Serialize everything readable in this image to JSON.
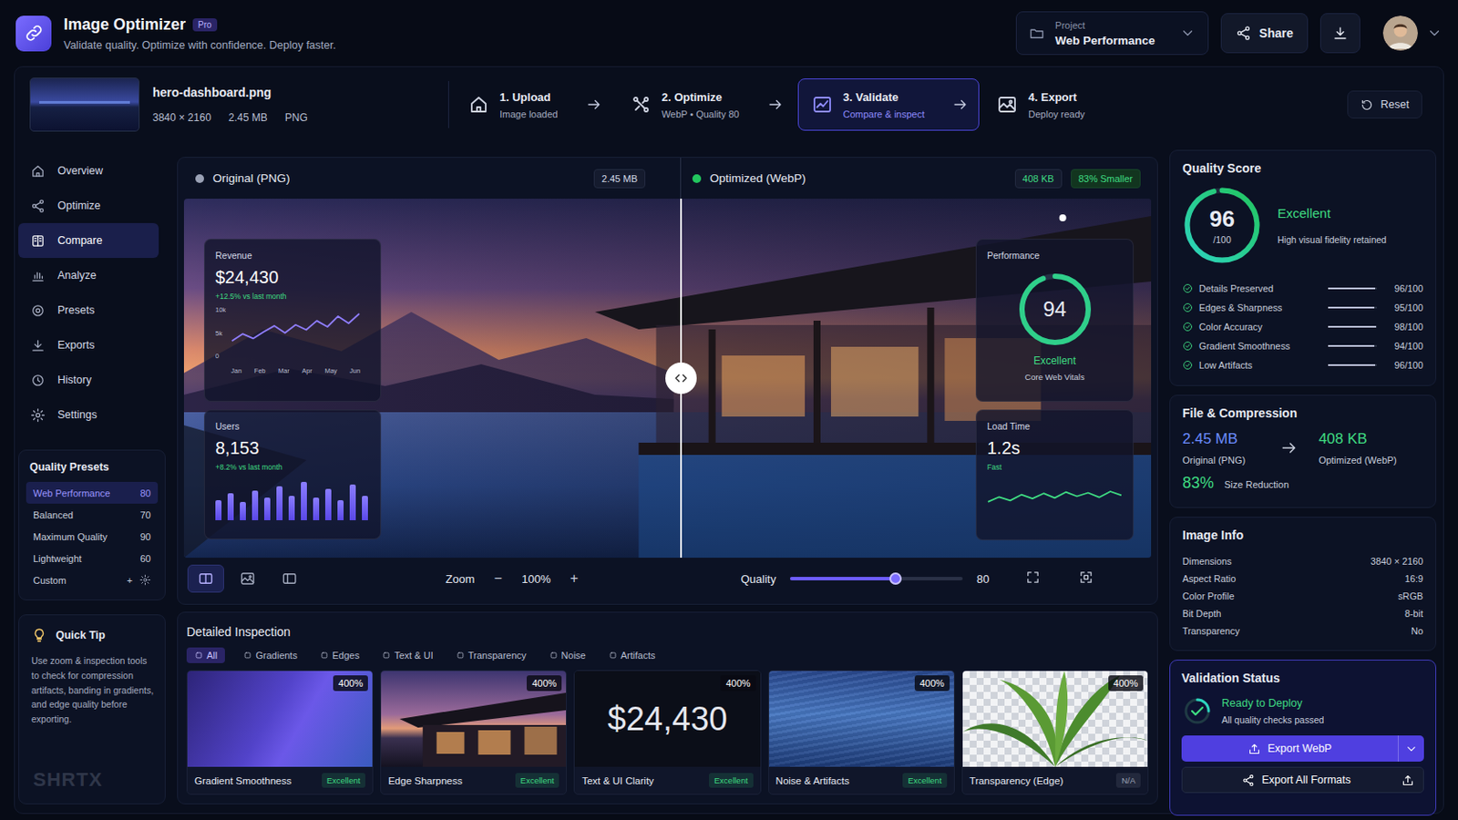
{
  "app": {
    "title": "Image Optimizer",
    "badge": "Pro",
    "subtitle": "Validate quality. Optimize with confidence. Deploy faster."
  },
  "project": {
    "label": "Project",
    "value": "Web Performance"
  },
  "header_actions": {
    "share": "Share"
  },
  "file": {
    "name": "hero-dashboard.png",
    "dimensions": "3840 × 2160",
    "size": "2.45 MB",
    "format": "PNG"
  },
  "steps": [
    {
      "title": "1. Upload",
      "subtitle": "Image loaded",
      "selected": false
    },
    {
      "title": "2. Optimize",
      "subtitle": "WebP • Quality 80",
      "selected": false
    },
    {
      "title": "3. Validate",
      "subtitle": "Compare & inspect",
      "selected": true
    },
    {
      "title": "4. Export",
      "subtitle": "Deploy ready",
      "selected": false
    }
  ],
  "reset": "Reset",
  "sidebar": {
    "items": [
      {
        "label": "Overview",
        "selected": false
      },
      {
        "label": "Optimize",
        "selected": false
      },
      {
        "label": "Compare",
        "selected": true
      },
      {
        "label": "Analyze",
        "selected": false
      },
      {
        "label": "Presets",
        "selected": false
      },
      {
        "label": "Exports",
        "selected": false
      },
      {
        "label": "History",
        "selected": false
      },
      {
        "label": "Settings",
        "selected": false
      }
    ]
  },
  "presets": {
    "title": "Quality Presets",
    "items": [
      {
        "label": "Web Performance",
        "value": "80",
        "selected": true,
        "kind": "value"
      },
      {
        "label": "Balanced",
        "value": "70",
        "selected": false,
        "kind": "value"
      },
      {
        "label": "Maximum Quality",
        "value": "90",
        "selected": false,
        "kind": "value"
      },
      {
        "label": "Lightweight",
        "value": "60",
        "selected": false,
        "kind": "value"
      },
      {
        "label": "Custom",
        "value": "+",
        "selected": false,
        "kind": "custom"
      }
    ]
  },
  "tip": {
    "title": "Quick Tip",
    "text": "Use zoom & inspection tools to check for compression artifacts, banding in gradients, and edge quality before exporting."
  },
  "brand": "SHRTX",
  "compare": {
    "original": {
      "label": "Original (PNG)",
      "size": "2.45 MB"
    },
    "optimized": {
      "label": "Optimized (WebP)",
      "size": "408 KB",
      "badge": "83% Smaller"
    },
    "split": {
      "level": 0.514
    },
    "revenue": {
      "label": "Revenue",
      "value": "$24,430",
      "delta": "+12.5% vs last month",
      "y_ticks": [
        "10k",
        "5k",
        "0"
      ],
      "x_ticks": [
        "Jan",
        "Feb",
        "Mar",
        "Apr",
        "May",
        "Jun"
      ],
      "values": [
        3.4,
        4.8,
        3.9,
        5.2,
        6.4,
        5.0,
        6.6,
        5.6,
        7.4,
        6.2,
        8.3,
        6.9,
        8.8
      ]
    },
    "users": {
      "label": "Users",
      "value": "8,153",
      "delta": "+8.2% vs last month",
      "values": [
        45,
        60,
        40,
        65,
        50,
        75,
        55,
        85,
        50,
        70,
        45,
        80,
        55
      ]
    },
    "performance": {
      "label": "Performance",
      "score": "94",
      "level": 0.94,
      "rating": "Excellent",
      "caption": "Core Web Vitals"
    },
    "load_time": {
      "label": "Load Time",
      "value": "1.2s",
      "rating": "Fast",
      "values": [
        30,
        45,
        34,
        52,
        40,
        56,
        42,
        60,
        47,
        58,
        44,
        62,
        50
      ]
    }
  },
  "toolbar": {
    "views": [
      {
        "selected": true
      },
      {
        "selected": false
      },
      {
        "selected": false
      }
    ],
    "zoom": {
      "label": "Zoom",
      "minus": "−",
      "value": "100%",
      "plus": "+"
    },
    "quality": {
      "label": "Quality",
      "level": 0.61,
      "value": "80"
    }
  },
  "inspection": {
    "title": "Detailed Inspection",
    "filters": [
      {
        "label": "All",
        "selected": true
      },
      {
        "label": "Gradients",
        "selected": false
      },
      {
        "label": "Edges",
        "selected": false
      },
      {
        "label": "Text & UI",
        "selected": false
      },
      {
        "label": "Transparency",
        "selected": false
      },
      {
        "label": "Noise",
        "selected": false
      },
      {
        "label": "Artifacts",
        "selected": false
      }
    ],
    "cards": [
      {
        "kind": "gradient",
        "zoom": "400%",
        "label": "Gradient Smoothness",
        "status": "Excellent",
        "color": "#3fdc82"
      },
      {
        "kind": "edge",
        "zoom": "400%",
        "label": "Edge Sharpness",
        "status": "Excellent",
        "color": "#3fdc82"
      },
      {
        "kind": "text",
        "zoom": "400%",
        "sample": "$24,430",
        "label": "Text & UI Clarity",
        "status": "Excellent",
        "color": "#3fdc82"
      },
      {
        "kind": "noise",
        "zoom": "400%",
        "label": "Noise & Artifacts",
        "status": "Excellent",
        "color": "#3fdc82"
      },
      {
        "kind": "transparency",
        "zoom": "400%",
        "label": "Transparency (Edge)",
        "status": "N/A",
        "color": "#9aa1b5"
      }
    ]
  },
  "quality_score": {
    "title": "Quality Score",
    "score": "96",
    "max": "/100",
    "level": 0.96,
    "rating": "Excellent",
    "caption": "High visual fidelity retained",
    "metrics": [
      {
        "label": "Details Preserved",
        "value": "96/100",
        "level": 0.96
      },
      {
        "label": "Edges & Sharpness",
        "value": "95/100",
        "level": 0.95
      },
      {
        "label": "Color Accuracy",
        "value": "98/100",
        "level": 0.98
      },
      {
        "label": "Gradient Smoothness",
        "value": "94/100",
        "level": 0.94
      },
      {
        "label": "Low Artifacts",
        "value": "96/100",
        "level": 0.96
      }
    ]
  },
  "file_compression": {
    "title": "File & Compression",
    "original_size": "2.45 MB",
    "original_label": "Original (PNG)",
    "optimized_size": "408 KB",
    "optimized_label": "Optimized (WebP)",
    "reduction": "83%",
    "reduction_label": "Size Reduction"
  },
  "image_info": {
    "title": "Image Info",
    "rows": [
      {
        "label": "Dimensions",
        "value": "3840 × 2160"
      },
      {
        "label": "Aspect Ratio",
        "value": "16:9"
      },
      {
        "label": "Color Profile",
        "value": "sRGB"
      },
      {
        "label": "Bit Depth",
        "value": "8-bit"
      },
      {
        "label": "Transparency",
        "value": "No"
      }
    ]
  },
  "validation": {
    "title": "Validation Status",
    "status": "Ready to Deploy",
    "caption": "All quality checks passed",
    "primary": "Export WebP",
    "secondary": "Export All Formats"
  }
}
